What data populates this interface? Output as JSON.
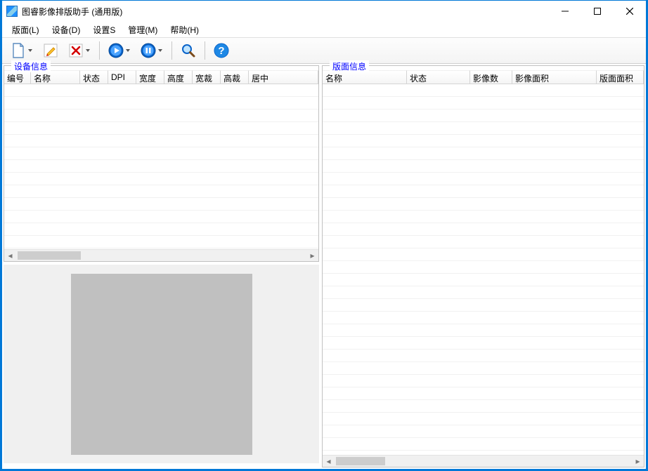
{
  "window": {
    "title": "图睿影像排版助手 (通用版)"
  },
  "menubar": {
    "items": [
      {
        "label": "版面(L)"
      },
      {
        "label": "设备(D)"
      },
      {
        "label": "设置S"
      },
      {
        "label": "管理(M)"
      },
      {
        "label": "帮助(H)"
      }
    ]
  },
  "toolbar": {
    "items": [
      {
        "id": "new",
        "name": "new-button",
        "icon": "document-icon",
        "dropdown": true
      },
      {
        "id": "edit",
        "name": "edit-button",
        "icon": "pencil-icon",
        "dropdown": false
      },
      {
        "id": "delete",
        "name": "delete-button",
        "icon": "delete-x-icon",
        "dropdown": true
      },
      {
        "id": "sep1",
        "separator": true
      },
      {
        "id": "play",
        "name": "play-button",
        "icon": "play-circle-icon",
        "dropdown": true
      },
      {
        "id": "pause",
        "name": "pause-button",
        "icon": "pause-circle-icon",
        "dropdown": true
      },
      {
        "id": "sep2",
        "separator": true
      },
      {
        "id": "search",
        "name": "search-button",
        "icon": "magnifier-icon",
        "dropdown": false
      },
      {
        "id": "sep3",
        "separator": true
      },
      {
        "id": "help",
        "name": "help-button",
        "icon": "help-circle-icon",
        "dropdown": false
      }
    ]
  },
  "panels": {
    "device": {
      "title": "设备信息",
      "columns": [
        "编号",
        "名称",
        "状态",
        "DPI",
        "宽度",
        "高度",
        "宽裁",
        "高裁",
        "居中"
      ]
    },
    "layout": {
      "title": "版面信息",
      "columns": [
        "名称",
        "状态",
        "影像数",
        "影像面积",
        "版面面积"
      ]
    }
  }
}
